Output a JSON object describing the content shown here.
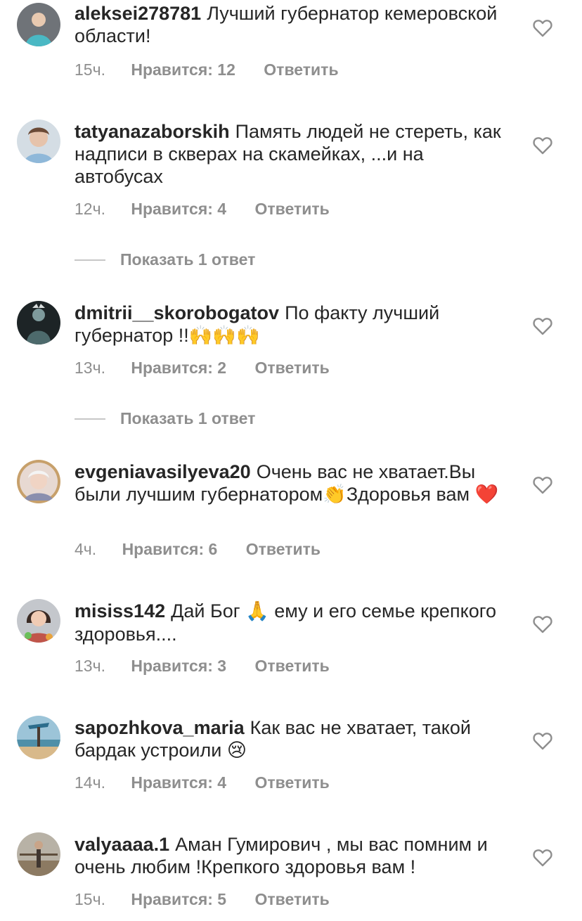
{
  "ui": {
    "like_prefix": "Нравится: ",
    "reply_label": "Ответить"
  },
  "comments": [
    {
      "username": "aleksei278781",
      "text": "Лучший губернатор кемеровской области!",
      "time": "15ч.",
      "likes_label": "Нравится: 12",
      "avatar_color": "#4aa5c7"
    },
    {
      "username": "tatyanazaborskih",
      "text": "Память людей не стереть, как надписи в скверах на скамейках, ...и на автобусах",
      "time": "12ч.",
      "likes_label": "Нравится: 4",
      "avatar_color": "#8fb8d9",
      "show_replies": "Показать 1 ответ"
    },
    {
      "username": "dmitrii__skorobogatov",
      "text": "По факту лучший губернатор !!",
      "emoji_tail": "🙌🙌🙌",
      "time": "13ч.",
      "likes_label": "Нравится: 2",
      "avatar_color": "#3b4a4c",
      "show_replies": "Показать 1 ответ"
    },
    {
      "username": "evgeniavasilyeva20",
      "text_before": "Очень вас не хватает.Вы были лучшим губернатором",
      "emoji_mid": "👏",
      "text_after": "Здоровья вам",
      "emoji_tail": "❤️",
      "time": "4ч.",
      "likes_label": "Нравится: 6",
      "avatar_color": "#9aa0b8"
    },
    {
      "username": "misiss142",
      "text_before": "Дай Бог",
      "emoji_mid": "🙏",
      "text_after": "ему и его семье крепкого здоровья....",
      "time": "13ч.",
      "likes_label": "Нравится: 3",
      "avatar_color": "#c0554a"
    },
    {
      "username": "sapozhkova_maria",
      "text": "Как вас не хватает, такой бардак устроили",
      "emoji_tail": "😢",
      "time": "14ч.",
      "likes_label": "Нравится: 4",
      "avatar_color": "#7fb5c9"
    },
    {
      "username": "valyaaaa.1",
      "text": "Аман Гумирович , мы вас помним и очень любим !Крепкого здоровья вам !",
      "time": "15ч.",
      "likes_label": "Нравится: 5",
      "avatar_color": "#a9a08e"
    }
  ],
  "colors": {
    "text": "#262626",
    "meta": "#8e8e8e",
    "divider": "#c7c7c7",
    "heart_outline": "#8e8e8e"
  }
}
